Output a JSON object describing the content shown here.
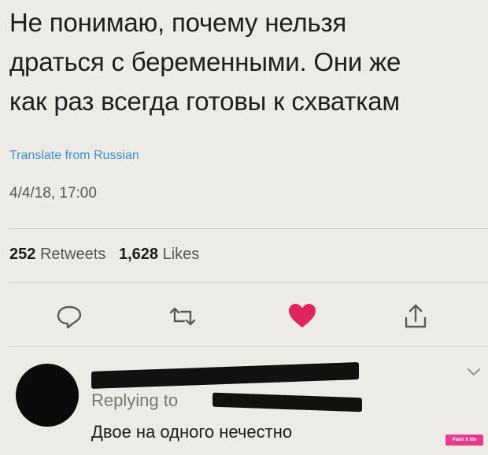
{
  "tweet": {
    "lines": [
      "Не понимаю, почему нельзя",
      "драться с беременными. Они же",
      "как раз всегда готовы к схваткам"
    ],
    "translate_label": "Translate from Russian",
    "timestamp": "4/4/18, 17:00"
  },
  "stats": {
    "retweets_count": "252",
    "retweets_label": "Retweets",
    "likes_count": "1,628",
    "likes_label": "Likes"
  },
  "actions": {
    "reply_icon": "reply-icon",
    "retweet_icon": "retweet-icon",
    "like_icon": "heart-icon",
    "share_icon": "share-icon",
    "like_color": "#e0245e"
  },
  "reply": {
    "replying_label": "Replying to",
    "text": "Двое на одного нечестно"
  },
  "watermark": {
    "text": "Paint X lite"
  }
}
